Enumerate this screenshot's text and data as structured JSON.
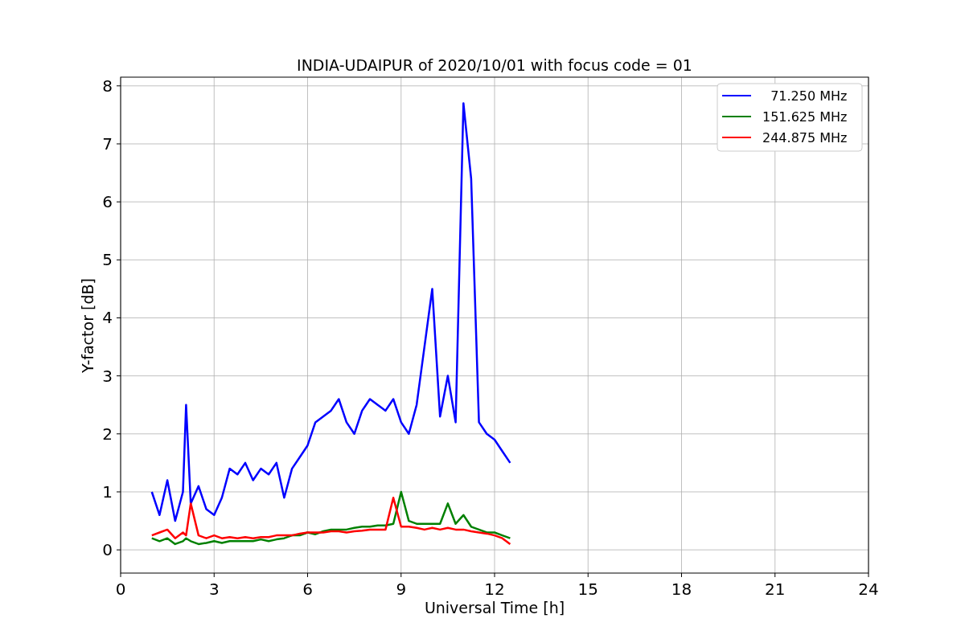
{
  "chart_data": {
    "type": "line",
    "title": "INDIA-UDAIPUR of 2020/10/01 with focus code = 01",
    "xlabel": "Universal Time [h]",
    "ylabel": "Y-factor [dB]",
    "x": [
      1.0,
      1.25,
      1.5,
      1.75,
      2.0,
      2.1,
      2.25,
      2.5,
      2.75,
      3.0,
      3.25,
      3.5,
      3.75,
      4.0,
      4.25,
      4.5,
      4.75,
      5.0,
      5.25,
      5.5,
      5.75,
      6.0,
      6.25,
      6.5,
      6.75,
      7.0,
      7.25,
      7.5,
      7.75,
      8.0,
      8.25,
      8.5,
      8.75,
      9.0,
      9.25,
      9.5,
      9.75,
      10.0,
      10.25,
      10.5,
      10.75,
      11.0,
      11.25,
      11.5,
      11.75,
      12.0,
      12.25,
      12.5
    ],
    "series": [
      {
        "name": "  71.250 MHz",
        "color": "#0000ff",
        "values": [
          1.0,
          0.6,
          1.2,
          0.5,
          1.0,
          2.5,
          0.8,
          1.1,
          0.7,
          0.6,
          0.9,
          1.4,
          1.3,
          1.5,
          1.2,
          1.4,
          1.3,
          1.5,
          0.9,
          1.4,
          1.6,
          1.8,
          2.2,
          2.3,
          2.4,
          2.6,
          2.2,
          2.0,
          2.4,
          2.6,
          2.5,
          2.4,
          2.6,
          2.2,
          2.0,
          2.5,
          3.5,
          4.5,
          2.3,
          3.0,
          2.2,
          7.7,
          6.4,
          2.2,
          2.0,
          1.9,
          1.7,
          1.5
        ]
      },
      {
        "name": "151.625 MHz",
        "color": "#008000",
        "values": [
          0.2,
          0.15,
          0.2,
          0.1,
          0.15,
          0.2,
          0.15,
          0.1,
          0.12,
          0.15,
          0.12,
          0.15,
          0.15,
          0.15,
          0.15,
          0.18,
          0.15,
          0.18,
          0.2,
          0.25,
          0.25,
          0.3,
          0.27,
          0.32,
          0.35,
          0.35,
          0.35,
          0.38,
          0.4,
          0.4,
          0.42,
          0.42,
          0.45,
          1.0,
          0.5,
          0.45,
          0.45,
          0.45,
          0.45,
          0.8,
          0.45,
          0.6,
          0.4,
          0.35,
          0.3,
          0.3,
          0.25,
          0.2
        ]
      },
      {
        "name": "244.875 MHz",
        "color": "#ff0000",
        "values": [
          0.25,
          0.3,
          0.35,
          0.2,
          0.3,
          0.25,
          0.8,
          0.25,
          0.2,
          0.25,
          0.2,
          0.22,
          0.2,
          0.22,
          0.2,
          0.22,
          0.22,
          0.25,
          0.25,
          0.25,
          0.28,
          0.3,
          0.3,
          0.3,
          0.32,
          0.32,
          0.3,
          0.32,
          0.33,
          0.35,
          0.35,
          0.35,
          0.9,
          0.4,
          0.4,
          0.38,
          0.35,
          0.38,
          0.35,
          0.38,
          0.35,
          0.35,
          0.32,
          0.3,
          0.28,
          0.25,
          0.2,
          0.1
        ]
      }
    ],
    "xlim": [
      0,
      24
    ],
    "ylim": [
      -0.4,
      8.15
    ],
    "xticks": [
      0,
      3,
      6,
      9,
      12,
      15,
      18,
      21,
      24
    ],
    "yticks": [
      0,
      1,
      2,
      3,
      4,
      5,
      6,
      7,
      8
    ],
    "grid": true,
    "legend": true
  }
}
